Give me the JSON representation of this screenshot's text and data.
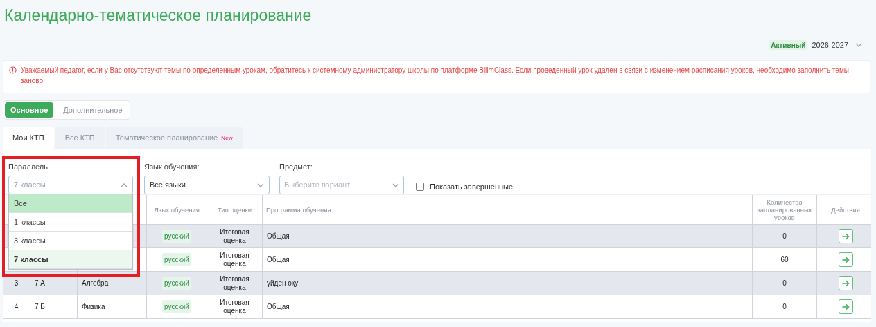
{
  "title": "Календарно-тематическое планирование",
  "year_selector": {
    "badge": "Активный",
    "value": "2026-2027"
  },
  "alert": {
    "text": "Уважаемый педагог, если у Вас отсутствуют темы по определенным урокам, обратитесь к системному администратору школы по платформе BilimClass. Если проведенный урок удален в связи с изменением расписания уроков, необходимо заполнить темы заново."
  },
  "mode_toggle": [
    {
      "label": "Основное",
      "selected": true
    },
    {
      "label": "Дополнительное",
      "selected": false
    }
  ],
  "tabs": [
    {
      "label": "Мои КТП",
      "selected": true
    },
    {
      "label": "Все КТП",
      "selected": false
    },
    {
      "label": "Тематическое планирование",
      "selected": false,
      "badge": "New"
    }
  ],
  "filters": {
    "parallel": {
      "label": "Параллель:",
      "placeholder": "7 классы",
      "expanded": true,
      "options": [
        {
          "label": "Все",
          "highlighted": true,
          "selected": false
        },
        {
          "label": "1 классы",
          "highlighted": false,
          "selected": false
        },
        {
          "label": "3 классы",
          "highlighted": false,
          "selected": false
        },
        {
          "label": "7 классы",
          "highlighted": false,
          "selected": true
        }
      ]
    },
    "language": {
      "label": "Язык обучения:",
      "value": "Все языки"
    },
    "subject": {
      "label": "Предмет:",
      "placeholder": "Выберите вариант"
    },
    "show_completed": {
      "label": "Показать завершенные",
      "checked": false
    }
  },
  "table": {
    "columns": [
      "Язык обучения",
      "Тип оценки",
      "Программа обучения",
      "Количество запланированных уроков",
      "Действия"
    ],
    "rows": [
      {
        "language": "русский",
        "grade_type": "Итоговая оценка",
        "program": "Общая",
        "lessons": "0"
      },
      {
        "language": "русский",
        "grade_type": "Итоговая оценка",
        "program": "Общая",
        "lessons": "60"
      },
      {
        "number": "3",
        "class": "7 А",
        "subject": "Алгебра",
        "language": "русский",
        "grade_type": "Итоговая оценка",
        "program": "үйден оқу",
        "lessons": "0"
      },
      {
        "number": "4",
        "class": "7 Б",
        "subject": "Физика",
        "language": "русский",
        "grade_type": "Итоговая оценка",
        "program": "Общая",
        "lessons": "0"
      }
    ]
  }
}
